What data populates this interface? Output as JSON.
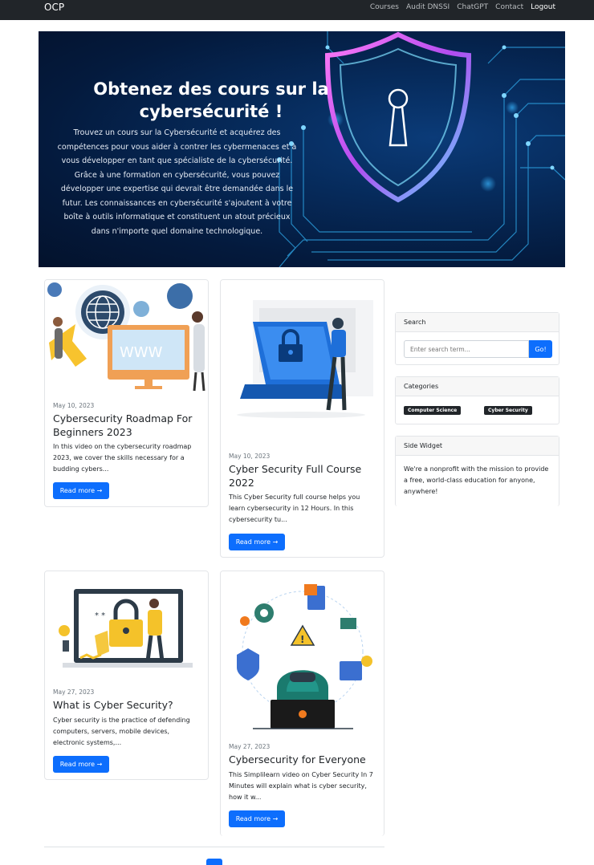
{
  "navbar": {
    "brand": "OCP",
    "links": [
      "Courses",
      "Audit DNSSI",
      "ChatGPT",
      "Contact",
      "Logout"
    ]
  },
  "hero": {
    "title": "Obtenez des cours sur la cybersécurité !",
    "text": "Trouvez un cours sur la Cybersécurité et acquérez des compétences pour vous aider à contrer les cybermenaces et à vous développer en tant que spécialiste de la cybersécurité. Grâce à une formation en cybersécurité, vous pouvez développer une expertise qui devrait être demandée dans le futur. Les connaissances en cybersécurité s'ajoutent à votre boîte à outils informatique et constituent un atout précieux dans n'importe quel domaine technologique."
  },
  "posts": [
    {
      "date": "May 10, 2023",
      "title": "Cybersecurity Roadmap For Beginners 2023",
      "excerpt": "In this video on the cybersecurity roadmap 2023, we cover the skills necessary for a budding cybers...",
      "button": "Read more →",
      "image_icon": "www-monitor-illustration"
    },
    {
      "date": "May 10, 2023",
      "title": "Cyber Security Full Course 2022",
      "excerpt": "This Cyber Security full course helps you learn cybersecurity in 12 Hours. In this cybersecurity tu...",
      "button": "Read more →",
      "image_icon": "laptop-lock-illustration"
    },
    {
      "date": "May 27, 2023",
      "title": "What is Cyber Security?",
      "excerpt": "Cyber security is the practice of defending computers, servers, mobile devices, electronic systems,...",
      "button": "Read more →",
      "image_icon": "padlock-screen-illustration"
    },
    {
      "date": "May 27, 2023",
      "title": "Cybersecurity for Everyone",
      "excerpt": "This Simplilearn video on Cyber Security In 7 Minutes will explain what is cyber security, how it w...",
      "button": "Read more →",
      "image_icon": "hacker-network-illustration"
    }
  ],
  "sidebar": {
    "search": {
      "title": "Search",
      "placeholder": "Enter search term...",
      "button": "Go!"
    },
    "categories": {
      "title": "Categories",
      "items": [
        "Computer Science",
        "Cyber Security"
      ]
    },
    "side_widget": {
      "title": "Side Widget",
      "text": "We're a nonprofit with the mission to provide a free, world-class education for anyone, anywhere!"
    }
  },
  "colors": {
    "primary": "#0d6efd",
    "navbar": "#212529",
    "hero_bg": "#062a5a",
    "shield_glow": "#e04cf0"
  }
}
